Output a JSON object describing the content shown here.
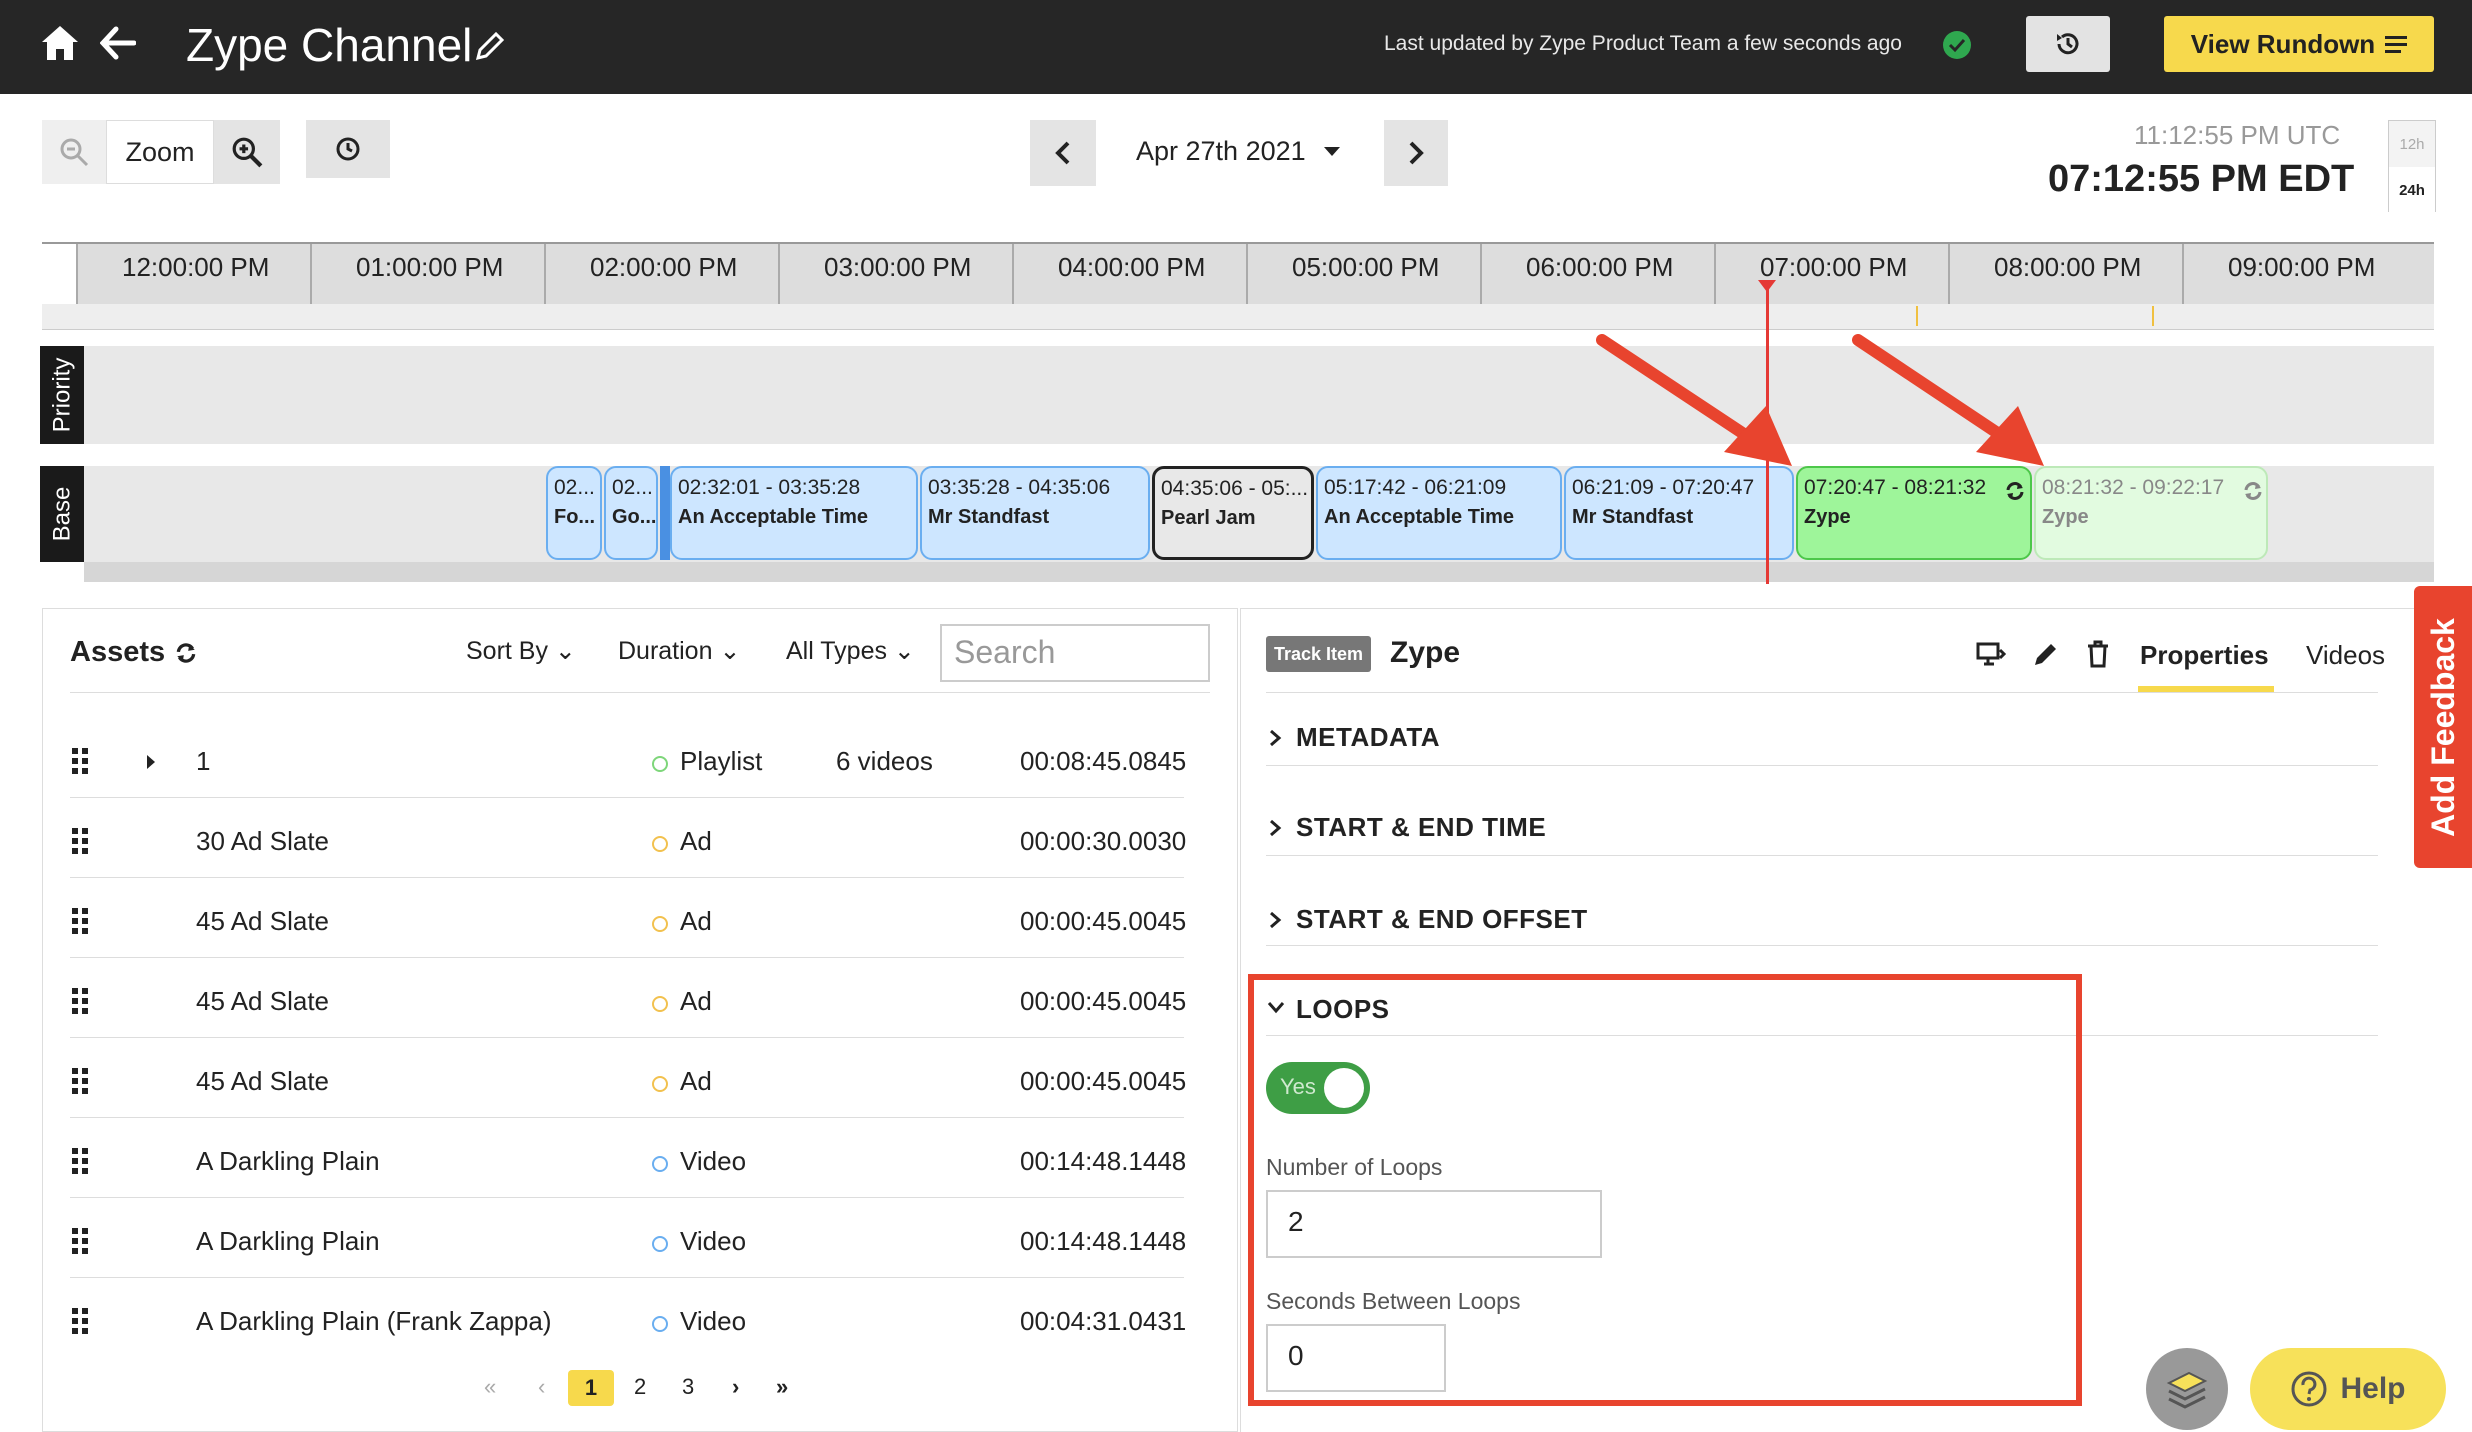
{
  "header": {
    "title": "Zype Channel",
    "updated": "Last updated by Zype Product Team a few seconds ago",
    "rundown_label": "View Rundown",
    "accent": "#f7d94c"
  },
  "controls": {
    "zoom_label": "Zoom",
    "date": "Apr 27th 2021",
    "utc_time": "11:12:55 PM UTC",
    "local_time": "07:12:55 PM EDT",
    "hour_12": "12h",
    "hour_24": "24h"
  },
  "timeline": {
    "ticks": [
      "12:00:00 PM",
      "01:00:00 PM",
      "02:00:00 PM",
      "03:00:00 PM",
      "04:00:00 PM",
      "05:00:00 PM",
      "06:00:00 PM",
      "07:00:00 PM",
      "08:00:00 PM",
      "09:00:00 PM"
    ],
    "lanes": [
      "Priority",
      "Base"
    ],
    "clips": [
      {
        "time": "02...",
        "name": "Fo..."
      },
      {
        "time": "02...",
        "name": "Go..."
      },
      {
        "time": "02:32:01 - 03:35:28",
        "name": "An Acceptable Time"
      },
      {
        "time": "03:35:28 - 04:35:06",
        "name": "Mr Standfast"
      },
      {
        "time": "04:35:06 - 05:...",
        "name": "Pearl Jam"
      },
      {
        "time": "05:17:42 - 06:21:09",
        "name": "An Acceptable Time"
      },
      {
        "time": "06:21:09 - 07:20:47",
        "name": "Mr Standfast"
      },
      {
        "time": "07:20:47 - 08:21:32",
        "name": "Zype"
      },
      {
        "time": "08:21:32 - 09:22:17",
        "name": "Zype"
      }
    ]
  },
  "assets": {
    "title": "Assets",
    "sort_by": "Sort By",
    "duration": "Duration",
    "all_types": "All Types",
    "search_placeholder": "Search",
    "rows": [
      {
        "name": "1",
        "type": "Playlist",
        "count": "6 videos",
        "duration": "00:08:45.0845",
        "color": "#7ed67a"
      },
      {
        "name": "30 Ad Slate",
        "type": "Ad",
        "count": "",
        "duration": "00:00:30.0030",
        "color": "#f2c14e"
      },
      {
        "name": "45 Ad Slate",
        "type": "Ad",
        "count": "",
        "duration": "00:00:45.0045",
        "color": "#f2c14e"
      },
      {
        "name": "45 Ad Slate",
        "type": "Ad",
        "count": "",
        "duration": "00:00:45.0045",
        "color": "#f2c14e"
      },
      {
        "name": "45 Ad Slate",
        "type": "Ad",
        "count": "",
        "duration": "00:00:45.0045",
        "color": "#f2c14e"
      },
      {
        "name": "A Darkling Plain",
        "type": "Video",
        "count": "",
        "duration": "00:14:48.1448",
        "color": "#6aaef0"
      },
      {
        "name": "A Darkling Plain",
        "type": "Video",
        "count": "",
        "duration": "00:14:48.1448",
        "color": "#6aaef0"
      },
      {
        "name": "A Darkling Plain (Frank Zappa)",
        "type": "Video",
        "count": "",
        "duration": "00:04:31.0431",
        "color": "#6aaef0"
      }
    ],
    "pages": [
      "1",
      "2",
      "3"
    ]
  },
  "props": {
    "badge": "Track Item",
    "name": "Zype",
    "tab_properties": "Properties",
    "tab_videos": "Videos",
    "sections": [
      "METADATA",
      "START & END TIME",
      "START & END OFFSET",
      "LOOPS"
    ],
    "toggle_label": "Yes",
    "loops_label": "Number of Loops",
    "loops_value": "2",
    "seconds_label": "Seconds Between Loops",
    "seconds_value": "0"
  },
  "feedback_label": "Add Feedback",
  "help_label": "Help"
}
